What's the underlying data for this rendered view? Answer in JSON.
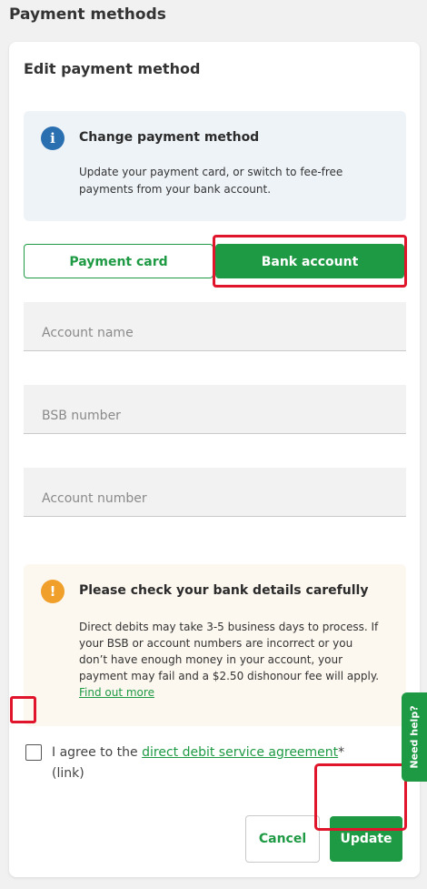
{
  "header": {
    "title": "Payment methods"
  },
  "card": {
    "title": "Edit payment method",
    "info": {
      "icon": "info-icon",
      "title": "Change payment method",
      "text": "Update your payment card, or switch to fee-free payments from your bank account."
    },
    "toggle": {
      "payment_card_label": "Payment card",
      "bank_account_label": "Bank account",
      "selected": "Bank account"
    },
    "fields": {
      "account_name_placeholder": "Account name",
      "bsb_placeholder": "BSB number",
      "account_number_placeholder": "Account number"
    },
    "warning": {
      "icon": "warning-icon",
      "title": "Please check your bank details carefully",
      "text": "Direct debits may take 3-5 business days to process. If your BSB or account numbers are incorrect or you don’t have enough money in your account, your payment may fail and a $2.50 dishonour fee will apply.",
      "link": "Find out more"
    },
    "agreement": {
      "prefix": "I agree to the ",
      "link": "direct debit service agreement",
      "suffix": "*",
      "link_note": "(link)"
    },
    "actions": {
      "cancel_label": "Cancel",
      "update_label": "Update"
    }
  },
  "help_tab": {
    "label": "Need help?"
  },
  "colors": {
    "brand_green": "#1f9a44",
    "highlight_red": "#e0142b",
    "info_blue": "#2a6fb0",
    "warning_orange": "#f0a02a"
  }
}
